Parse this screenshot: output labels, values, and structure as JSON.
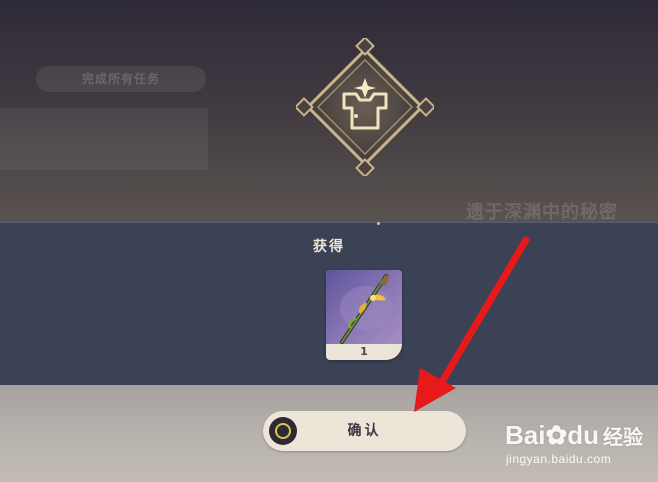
{
  "background": {
    "pill_text": "完成所有任务",
    "quest_title": "遗于深渊中的秘密"
  },
  "reward": {
    "title": "获得",
    "item": {
      "icon": "polearm-weapon-icon",
      "count": "1"
    }
  },
  "confirm_button": {
    "label": "确认",
    "icon": "circle-confirm-icon",
    "accent_color": "#e4c04d"
  },
  "annotation": {
    "arrow_color": "#e8191b"
  },
  "watermark": {
    "logo_text": "Bai",
    "logo_suffix": "du",
    "logo_cn": "经验",
    "url": "jingyan.baidu.com"
  }
}
